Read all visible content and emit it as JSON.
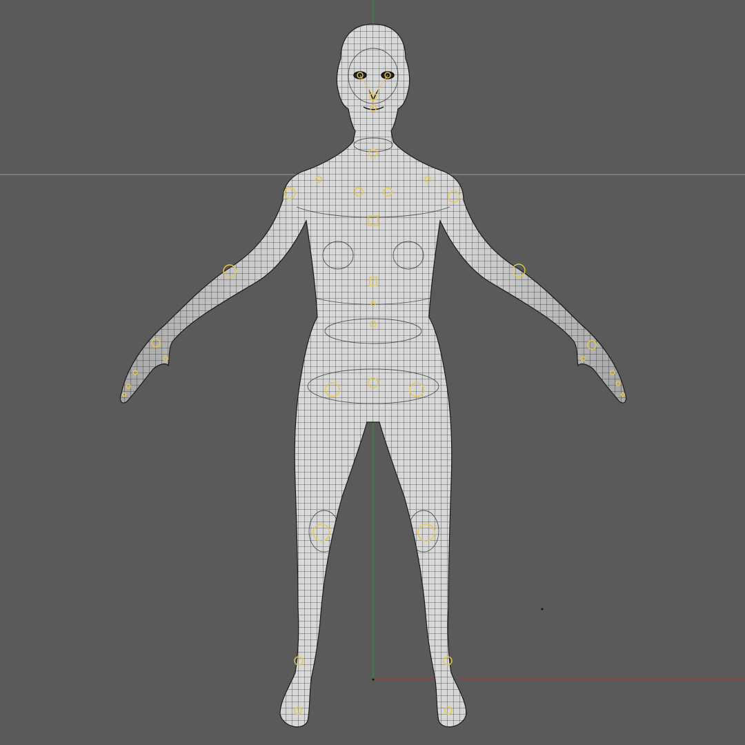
{
  "viewport": {
    "background": "#5a5a5a",
    "grid_line_color": "#9a9a9a",
    "y_axis_color": "#2e9a2e",
    "x_axis_color": "#b03030"
  },
  "model": {
    "skin_color": "#d2d2d2",
    "shadow_color": "#a8a8a8",
    "wire_color": "#1e1e1e",
    "rig_marker_color": "#e6c84a"
  }
}
